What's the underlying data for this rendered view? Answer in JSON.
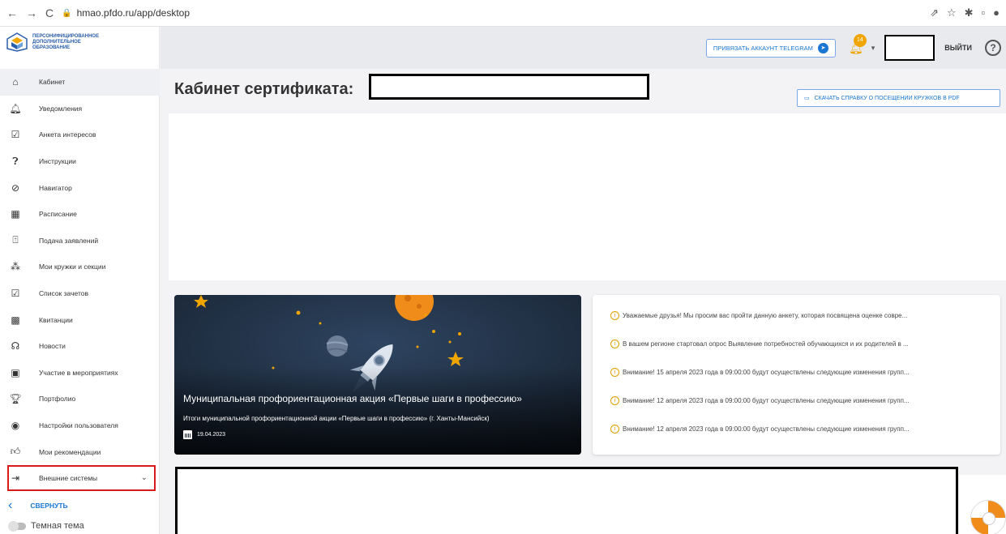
{
  "browser": {
    "url": "hmao.pfdo.ru/app/desktop"
  },
  "logo": {
    "line1": "ПЕРСОНИФИЦИРОВАННОЕ",
    "line2": "ДОПОЛНИТЕЛЬНОЕ",
    "line3": "ОБРАЗОВАНИЕ"
  },
  "sidebar": {
    "items": [
      {
        "label": "Кабинет",
        "icon": "home-icon"
      },
      {
        "label": "Уведомления",
        "icon": "bell-icon"
      },
      {
        "label": "Анкета интересов",
        "icon": "form-icon"
      },
      {
        "label": "Инструкции",
        "icon": "help-icon"
      },
      {
        "label": "Навигатор",
        "icon": "compass-icon"
      },
      {
        "label": "Расписание",
        "icon": "calendar-icon"
      },
      {
        "label": "Подача заявлений",
        "icon": "upload-icon"
      },
      {
        "label": "Мои кружки и секции",
        "icon": "sections-icon"
      },
      {
        "label": "Список зачетов",
        "icon": "list-icon"
      },
      {
        "label": "Квитанции",
        "icon": "qr-icon"
      },
      {
        "label": "Новости",
        "icon": "news-icon"
      },
      {
        "label": "Участие в мероприятиях",
        "icon": "event-icon"
      },
      {
        "label": "Портфолио",
        "icon": "trophy-icon"
      },
      {
        "label": "Настройки пользователя",
        "icon": "user-settings-icon"
      },
      {
        "label": "Мои рекомендации",
        "icon": "thumb-up-icon"
      },
      {
        "label": "Внешние системы",
        "icon": "external-icon"
      }
    ],
    "collapse_label": "СВЕРНУТЬ",
    "dark_theme_label": "Темная тема"
  },
  "topbar": {
    "telegram_label": "ПРИВЯЗАТЬ АККАУНТ TELEGRAM",
    "notifications_count": "14",
    "logout_label": "ВЫЙТИ",
    "help_label": "?"
  },
  "main": {
    "title": "Кабинет сертификата:",
    "pdf_button_label": "СКАЧАТЬ СПРАВКУ О ПОСЕЩЕНИИ КРУЖКОВ В PDF",
    "card": {
      "title": "Муниципальная профориентационная акция «Первые шаги в профессию»",
      "subtitle": "Итоги муниципальной профориентационной акции «Первые шаги в профессию» (г. Ханты-Мансийск)",
      "date": "19.04.2023"
    },
    "news": [
      "Уважаемые друзья! Мы просим вас пройти данную анкету, которая посвящена оценке совре...",
      "В вашем регионе стартовал опрос Выявление потребностей обучающихся и их родителей в ...",
      "Внимание! 15 апреля 2023 года в 09:00:00 будут осуществлены следующие изменения групп...",
      "Внимание! 12 апреля 2023 года в 09:00:00 будут осуществлены следующие изменения групп...",
      "Внимание! 12 апреля 2023 года в 09:00:00 будут осуществлены следующие изменения групп..."
    ]
  },
  "colors": {
    "accent": "#1976d2",
    "warning": "#f0a500",
    "highlight": "#d81b1b"
  }
}
